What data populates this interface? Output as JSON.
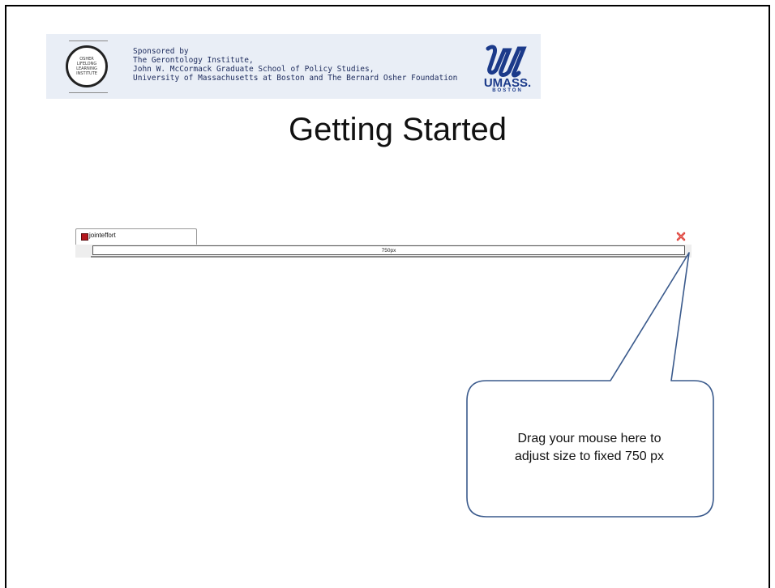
{
  "banner": {
    "logo_text": "OSHER\nLIFELONG\nLEARNING\nINSTITUTE",
    "sponsor_lines": [
      "Sponsored by",
      "The Gerontology Institute,",
      "John W. McCormack Graduate School of Policy Studies,",
      "University of Massachusetts at Boston and The Bernard Osher Foundation"
    ],
    "umass_word": "UMASS.",
    "umass_sub": "BOSTON"
  },
  "slide": {
    "title": "Getting Started"
  },
  "browser": {
    "tab_label": "jointeffort",
    "resize_value": "750px",
    "colors": {
      "tab_icon": "#b3161c",
      "close_icon": "#d9302a"
    }
  },
  "callout": {
    "lines": [
      "Drag your mouse here to",
      "adjust size to fixed 750 px"
    ],
    "border_color": "#3a5a8c"
  }
}
